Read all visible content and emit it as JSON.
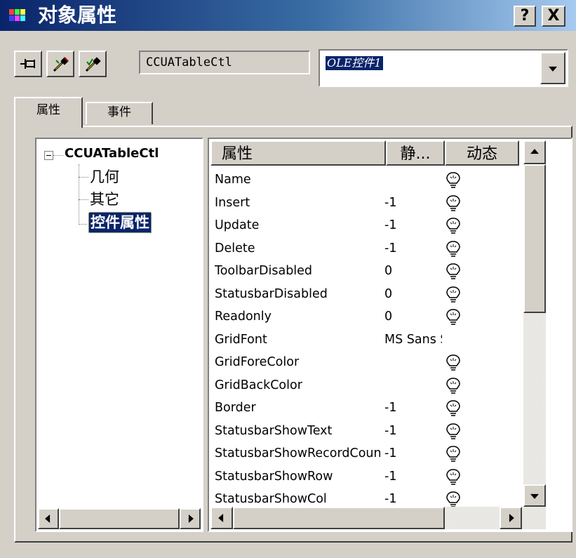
{
  "window": {
    "title": "对象属性",
    "help_label": "?",
    "close_label": "X"
  },
  "toolbar": {
    "class_name": "CCUATableCtl",
    "object_name": "OLE控件1"
  },
  "tabs": [
    {
      "label": "属性",
      "active": true
    },
    {
      "label": "事件",
      "active": false
    }
  ],
  "tree": {
    "root": "CCUATableCtl",
    "children": [
      "几何",
      "其它",
      "控件属性"
    ],
    "selected": "控件属性"
  },
  "grid": {
    "columns": [
      "属性",
      "静...",
      "动态"
    ],
    "rows": [
      {
        "name": "Name",
        "static": "",
        "swatch": null,
        "dynamic": true
      },
      {
        "name": "Insert",
        "static": "-1",
        "swatch": null,
        "dynamic": true
      },
      {
        "name": "Update",
        "static": "-1",
        "swatch": null,
        "dynamic": true
      },
      {
        "name": "Delete",
        "static": "-1",
        "swatch": null,
        "dynamic": true
      },
      {
        "name": "ToolbarDisabled",
        "static": "0",
        "swatch": null,
        "dynamic": true
      },
      {
        "name": "StatusbarDisabled",
        "static": "0",
        "swatch": null,
        "dynamic": true
      },
      {
        "name": "Readonly",
        "static": "0",
        "swatch": null,
        "dynamic": true
      },
      {
        "name": "GridFont",
        "static": "MS Sans Serif",
        "swatch": null,
        "dynamic": false
      },
      {
        "name": "GridForeColor",
        "static": "",
        "swatch": "#000000",
        "dynamic": true
      },
      {
        "name": "GridBackColor",
        "static": "",
        "swatch": "#ffffff",
        "dynamic": true
      },
      {
        "name": "Border",
        "static": "-1",
        "swatch": null,
        "dynamic": true
      },
      {
        "name": "StatusbarShowText",
        "static": "-1",
        "swatch": null,
        "dynamic": true
      },
      {
        "name": "StatusbarShowRecordCount",
        "static": "-1",
        "swatch": null,
        "dynamic": true
      },
      {
        "name": "StatusbarShowRow",
        "static": "-1",
        "swatch": null,
        "dynamic": true
      },
      {
        "name": "StatusbarShowCol",
        "static": "-1",
        "swatch": null,
        "dynamic": true
      }
    ]
  },
  "colors": {
    "title_gradient_start": "#0a246a",
    "title_gradient_end": "#a6caf0",
    "selection": "#0a246a",
    "face": "#d4d0c8"
  },
  "icons": {
    "pin": "pin-icon",
    "picker_1": "eyedropper-icon",
    "picker_2": "eyedropper-check-icon",
    "dynamic": "lightbulb-icon"
  }
}
